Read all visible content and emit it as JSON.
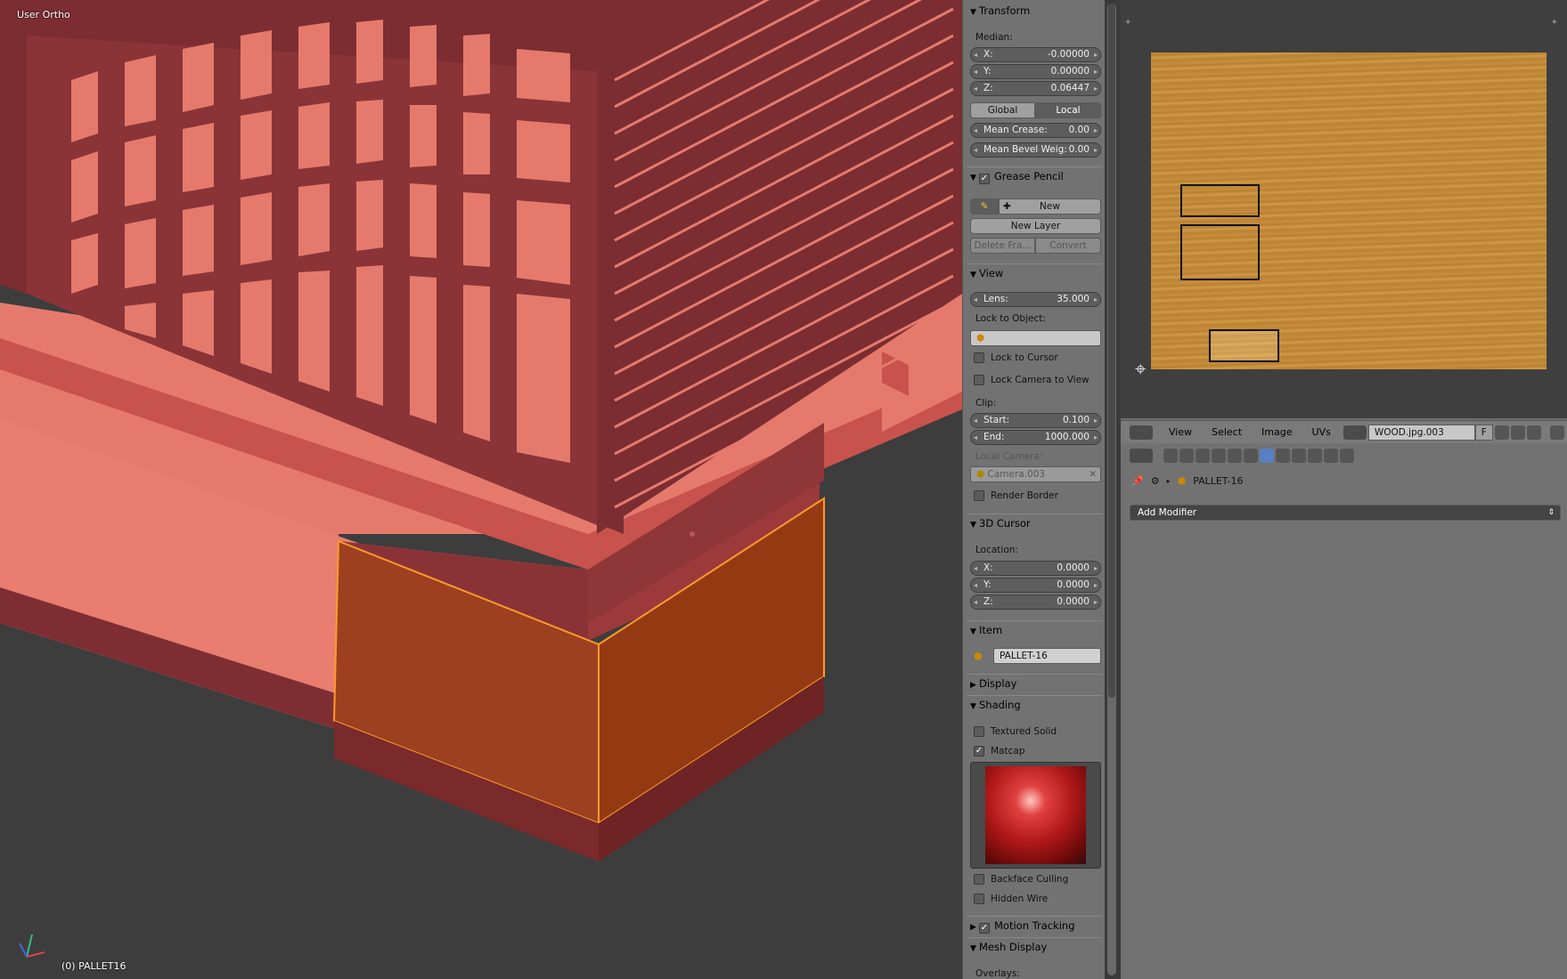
{
  "viewport": {
    "title": "User Ortho",
    "object_label": "(0) PALLET16"
  },
  "npanel": {
    "transform": {
      "title": "Transform",
      "median_label": "Median:",
      "x_label": "X:",
      "x_value": "-0.00000",
      "y_label": "Y:",
      "y_value": "0.00000",
      "z_label": "Z:",
      "z_value": "0.06447",
      "global_label": "Global",
      "local_label": "Local",
      "mean_crease_label": "Mean Crease:",
      "mean_crease_value": "0.00",
      "mean_bevel_label": "Mean Bevel Weig:",
      "mean_bevel_value": "0.00"
    },
    "grease_pencil": {
      "title": "Grease Pencil",
      "new_label": "New",
      "new_layer_label": "New Layer",
      "delete_frame_label": "Delete Fra...",
      "convert_label": "Convert"
    },
    "view": {
      "title": "View",
      "lens_label": "Lens:",
      "lens_value": "35.000",
      "lock_object_label": "Lock to Object:",
      "lock_cursor_label": "Lock to Cursor",
      "lock_camera_label": "Lock Camera to View",
      "clip_label": "Clip:",
      "start_label": "Start:",
      "start_value": "0.100",
      "end_label": "End:",
      "end_value": "1000.000",
      "local_camera_label": "Local Camera:",
      "camera_value": "Camera.003",
      "render_border_label": "Render Border"
    },
    "cursor": {
      "title": "3D Cursor",
      "location_label": "Location:",
      "x_label": "X:",
      "x_value": "0.0000",
      "y_label": "Y:",
      "y_value": "0.0000",
      "z_label": "Z:",
      "z_value": "0.0000"
    },
    "item": {
      "title": "Item",
      "name_value": "PALLET-16"
    },
    "display": {
      "title": "Display"
    },
    "shading": {
      "title": "Shading",
      "textured_solid_label": "Textured Solid",
      "matcap_label": "Matcap",
      "backface_label": "Backface Culling",
      "hidden_wire_label": "Hidden Wire"
    },
    "motion_tracking": {
      "title": "Motion Tracking"
    },
    "mesh_display": {
      "title": "Mesh Display",
      "overlays_label": "Overlays:"
    }
  },
  "image_editor": {
    "menu_view": "View",
    "menu_select": "Select",
    "menu_image": "Image",
    "menu_uvs": "UVs",
    "image_name": "WOOD.jpg.003",
    "fake_user": "F"
  },
  "properties": {
    "breadcrumb_object": "PALLET-16",
    "add_modifier_label": "Add Modifier"
  },
  "colors": {
    "mesh_light": "#e57a6c",
    "mesh_mid": "#c8524c",
    "mesh_dark": "#7e2e32",
    "selected": "#9a3f18",
    "selected_edge": "#ff9a2a",
    "wood": "#c08a3a"
  }
}
